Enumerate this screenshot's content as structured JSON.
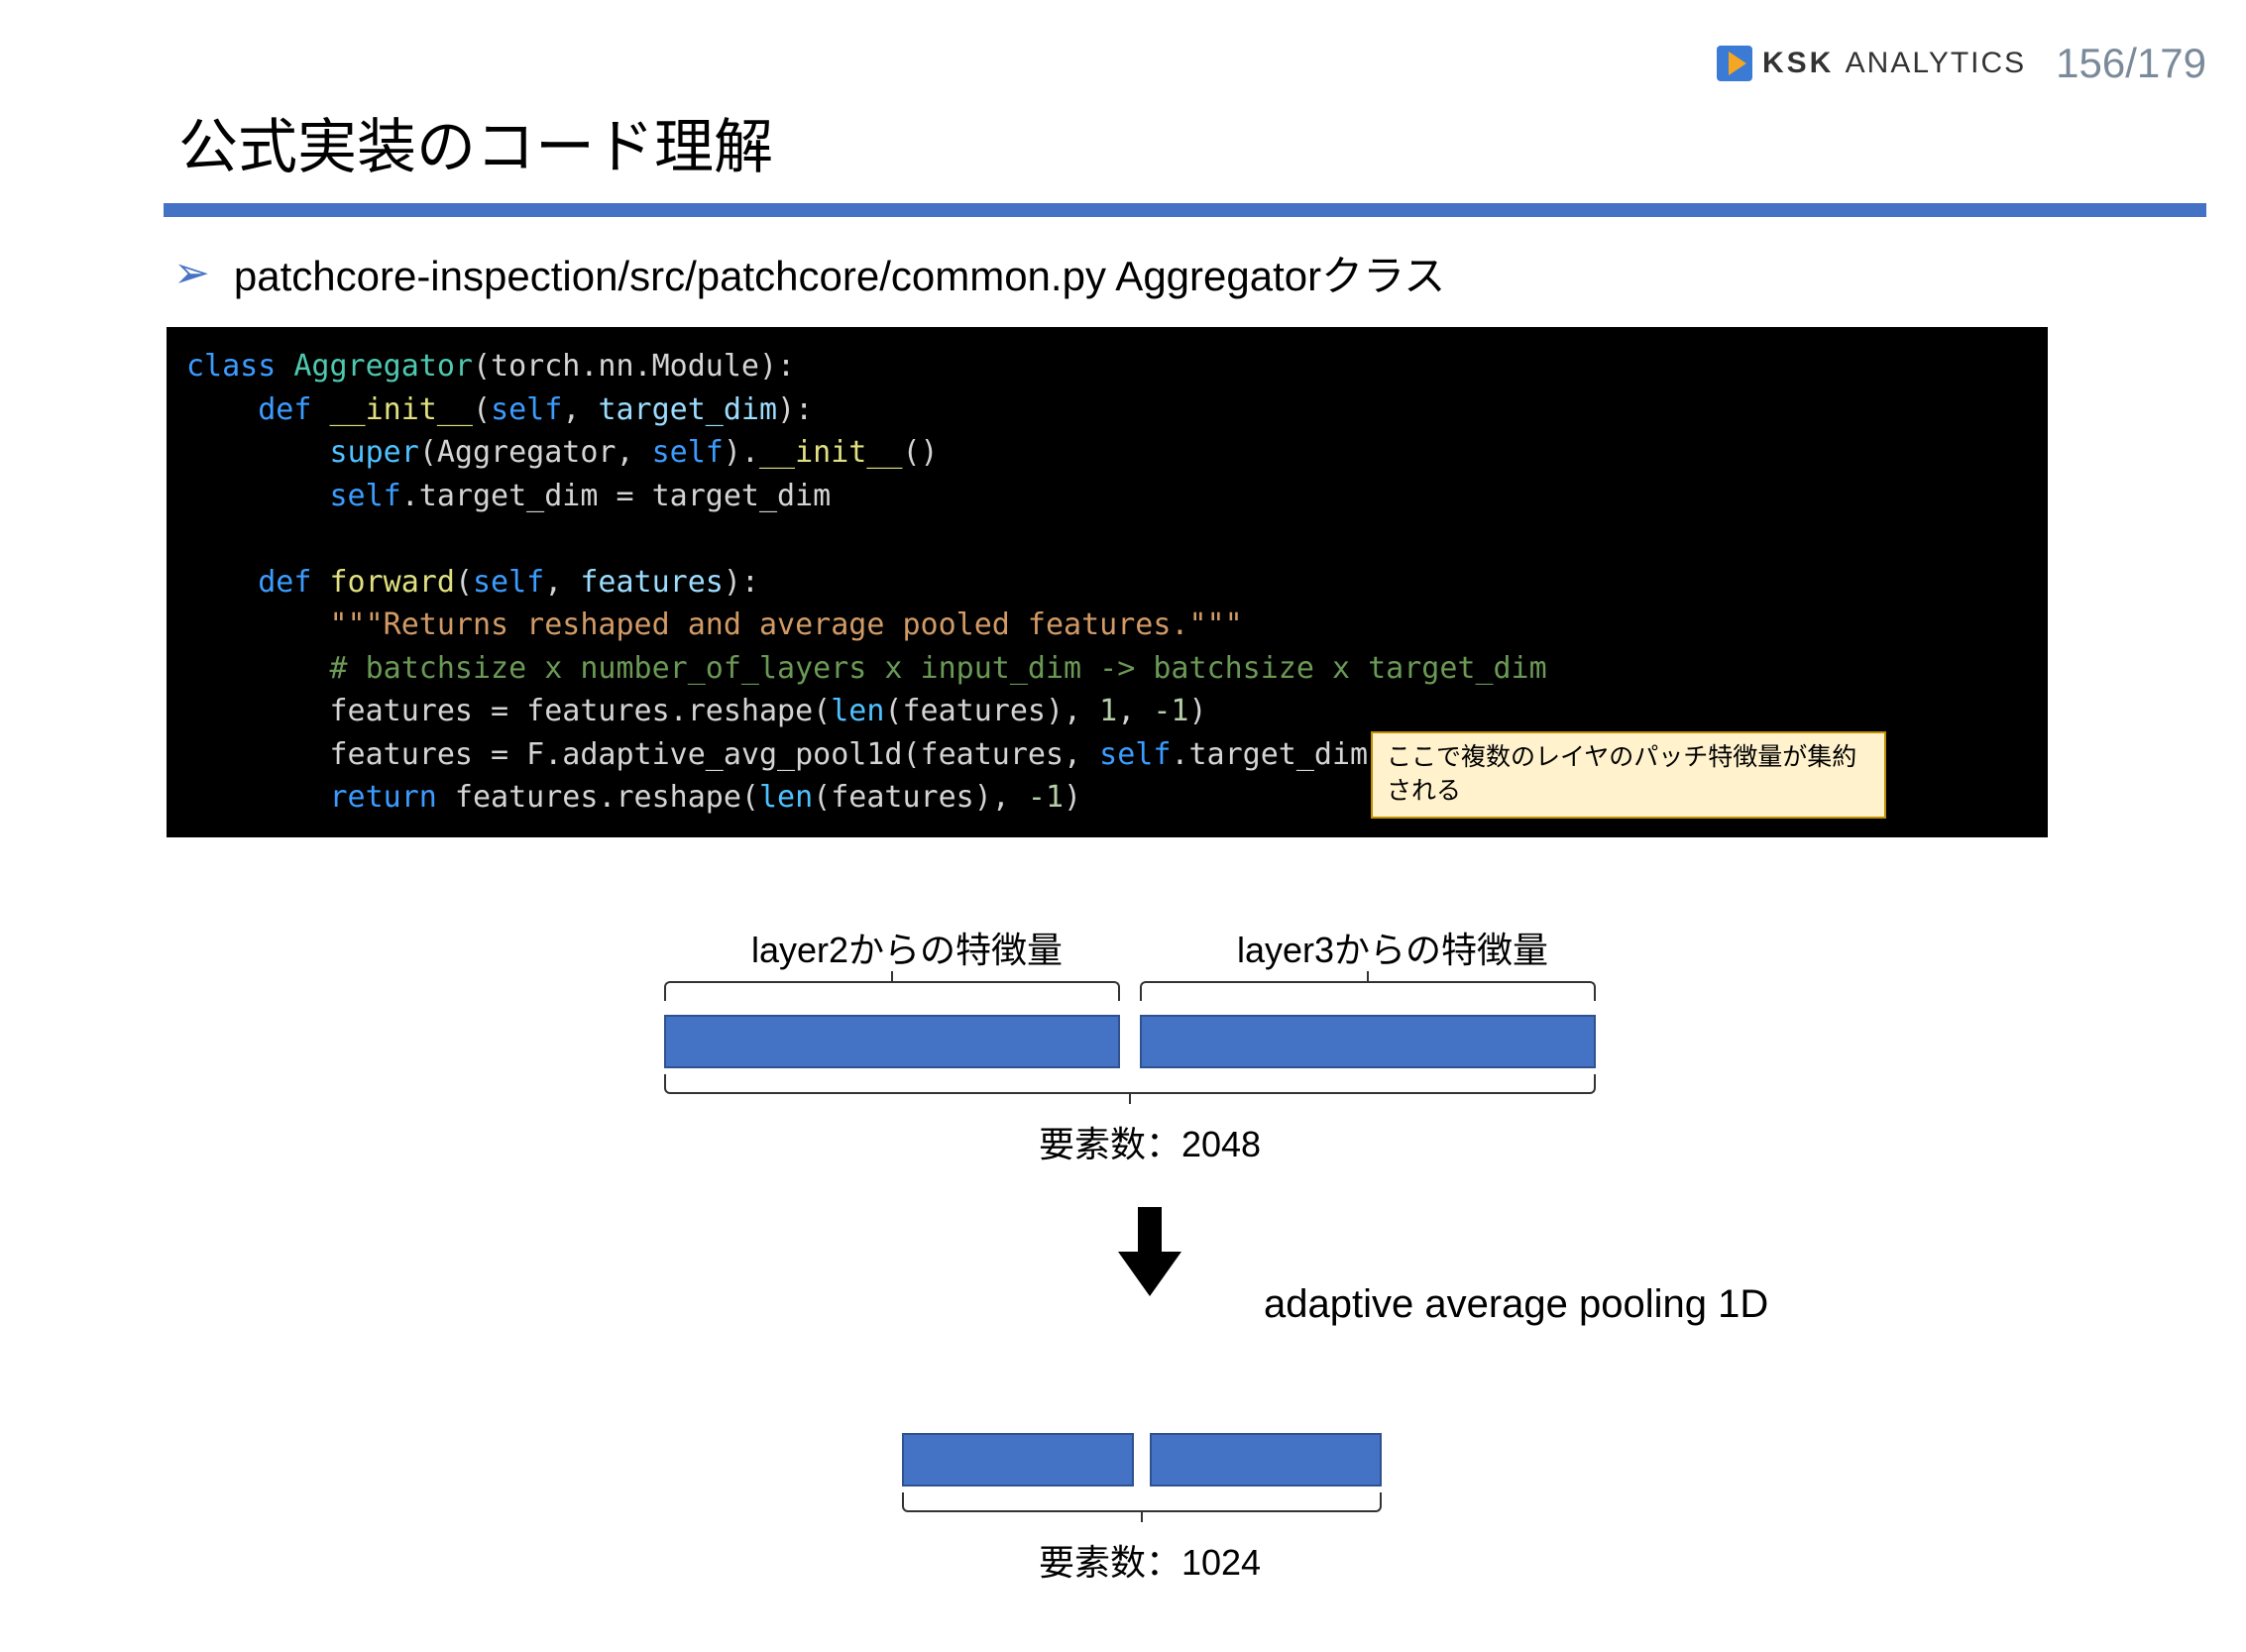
{
  "header": {
    "brand_bold": "KSK",
    "brand_light": "ANALYTICS",
    "page_counter": "156/179"
  },
  "title": "公式実装のコード理解",
  "bullet": {
    "text": "patchcore-inspection/src/patchcore/common.py Aggregatorクラス"
  },
  "code": {
    "l1_kw1": "class",
    "l1_cls": "Aggregator",
    "l1_paren": "(torch.nn.Module):",
    "l2_kw": "def",
    "l2_fn": "__init__",
    "l2_sig": "(",
    "l2_self": "self",
    "l2_c": ", ",
    "l2_p": "target_dim",
    "l2_end": "):",
    "l3a": "super",
    "l3b": "(Aggregator, ",
    "l3_self": "self",
    "l3c": ").",
    "l3_fn": "__init__",
    "l3d": "()",
    "l4_self": "self",
    "l4a": ".target_dim = target_dim",
    "l5_kw": "def",
    "l5_fn": "forward",
    "l5_sig": "(",
    "l5_self": "self",
    "l5_c": ", ",
    "l5_p": "features",
    "l5_end": "):",
    "l6_str": "\"\"\"Returns reshaped and average pooled features.\"\"\"",
    "l7_cmt": "# batchsize x number_of_layers x input_dim -> batchsize x target_dim",
    "l8a": "features = features.reshape(",
    "l8_len": "len",
    "l8b": "(features), ",
    "l8_n1": "1",
    "l8c": ", ",
    "l8_n2": "-1",
    "l8d": ")",
    "l9a": "features = F.adaptive_avg_pool1d(features, ",
    "l9_self": "self",
    "l9b": ".target_dim)",
    "l10_kw": "return",
    "l10a": " features.reshape(",
    "l10_len": "len",
    "l10b": "(features), ",
    "l10_n": "-1",
    "l10c": ")"
  },
  "note": "ここで複数のレイヤのパッチ特徴量が集約される",
  "diagram": {
    "layer2_label": "layer2からの特徴量",
    "layer3_label": "layer3からの特徴量",
    "count1": "要素数：2048",
    "pool_label": "adaptive average pooling 1D",
    "count2": "要素数：1024"
  }
}
